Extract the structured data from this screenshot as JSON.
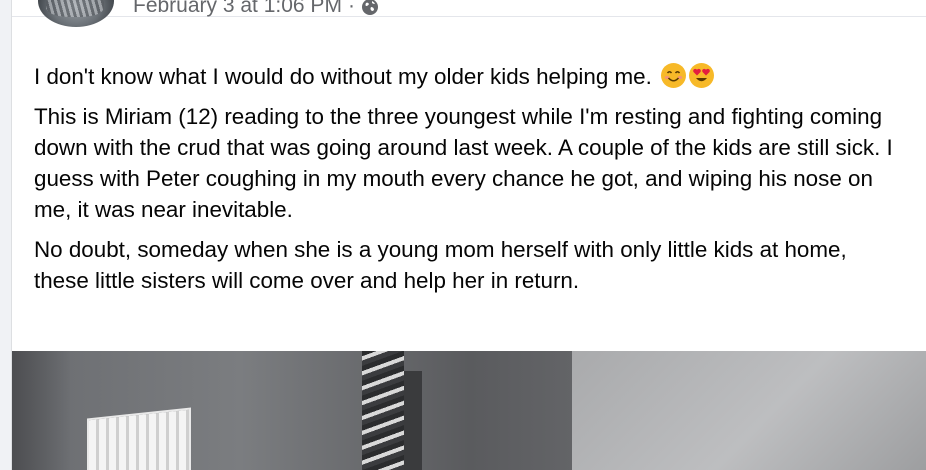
{
  "post": {
    "timestamp": "February 3 at 1:06 PM",
    "separator": "·",
    "audience_icon": "globe-icon",
    "paragraphs": [
      "I don't know what I would do without my older kids helping me.",
      "This is Miriam (12) reading to the three youngest while I'm resting and fighting coming down with the crud that was going around last week. A couple of the kids are still sick. I guess with Peter coughing in my mouth every chance he got, and wiping his nose on me, it was near inevitable.",
      "No doubt, someday when she is a young mom herself with only little kids at home, these little sisters will come over and help her in return."
    ],
    "emojis": [
      "smiling-face-icon",
      "heart-eyes-icon"
    ]
  },
  "colors": {
    "text": "#050505",
    "secondary_text": "#65676b",
    "page_background": "#f0f2f5",
    "card_background": "#ffffff",
    "emoji_yellow": "#f7b928",
    "emoji_heart": "#e41e3f"
  }
}
